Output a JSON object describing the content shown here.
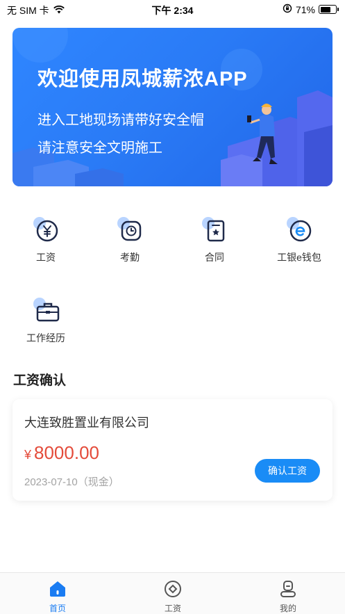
{
  "status_bar": {
    "carrier": "无 SIM 卡",
    "time": "下午 2:34",
    "battery_percent": "71%",
    "battery_level": 0.71
  },
  "banner": {
    "title": "欢迎使用凤城薪浓APP",
    "line1": "进入工地现场请带好安全帽",
    "line2": "请注意安全文明施工"
  },
  "grid": {
    "items": [
      {
        "label": "工资",
        "icon": "yen-icon"
      },
      {
        "label": "考勤",
        "icon": "attendance-clock-icon"
      },
      {
        "label": "合同",
        "icon": "contract-icon"
      },
      {
        "label": "工银e钱包",
        "icon": "e-wallet-icon"
      },
      {
        "label": "工作经历",
        "icon": "briefcase-icon"
      }
    ]
  },
  "wage_confirm": {
    "section_title": "工资确认",
    "card": {
      "company": "大连致胜置业有限公司",
      "currency": "¥",
      "amount": "8000.00",
      "date": "2023-07-10（现金）",
      "button_label": "确认工资"
    }
  },
  "tabbar": {
    "items": [
      {
        "label": "首页",
        "icon": "home-icon",
        "active": true
      },
      {
        "label": "工资",
        "icon": "wage-target-icon",
        "active": false
      },
      {
        "label": "我的",
        "icon": "profile-icon",
        "active": false
      }
    ]
  },
  "colors": {
    "accent": "#1a8cf6",
    "banner_blue": "#2a7bf6",
    "amount_red": "#e44b3a"
  }
}
